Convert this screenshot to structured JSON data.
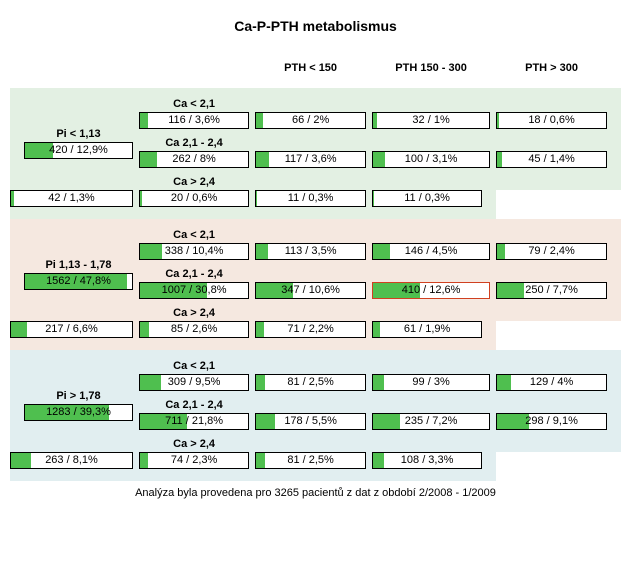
{
  "title": "Ca-P-PTH metabolismus",
  "footer": "Analýza byla provedena pro 3265 pacientů z dat z období 2/2008 - 1/2009",
  "headers": {
    "pth1": "PTH < 150",
    "pth2": "PTH 150 - 300",
    "pth3": "PTH > 300"
  },
  "pi_labels": [
    "Pi < 1,13",
    "Pi 1,13 - 1,78",
    "Pi > 1,78"
  ],
  "ca_labels": [
    "Ca < 2,1",
    "Ca 2,1 - 2,4",
    "Ca > 2,4"
  ],
  "chart_data": {
    "type": "table",
    "note": "Each cell shows count/percent of total (N=3265). pct_raw used for bar fill width in percent.",
    "total_n": 3265,
    "pi_bins": [
      "Pi < 1,13",
      "Pi 1,13 - 1,78",
      "Pi > 1,78"
    ],
    "ca_bins": [
      "Ca < 2,1",
      "Ca 2,1 - 2,4",
      "Ca > 2,4"
    ],
    "pth_bins": [
      "PTH < 150",
      "PTH 150 - 300",
      "PTH > 300"
    ],
    "pi_totals": [
      {
        "text": "420 / 12,9%",
        "pct_raw": 12.9
      },
      {
        "text": "1562 / 47,8%",
        "pct_raw": 47.8
      },
      {
        "text": "1283 / 39,3%",
        "pct_raw": 39.3
      }
    ],
    "ca_totals": [
      [
        {
          "text": "116 / 3,6%",
          "pct_raw": 3.6
        },
        {
          "text": "262 / 8%",
          "pct_raw": 8.0
        },
        {
          "text": "42 / 1,3%",
          "pct_raw": 1.3
        }
      ],
      [
        {
          "text": "338 / 10,4%",
          "pct_raw": 10.4
        },
        {
          "text": "1007 / 30,8%",
          "pct_raw": 30.8
        },
        {
          "text": "217 / 6,6%",
          "pct_raw": 6.6
        }
      ],
      [
        {
          "text": "309 / 9,5%",
          "pct_raw": 9.5
        },
        {
          "text": "711 / 21,8%",
          "pct_raw": 21.8
        },
        {
          "text": "263 / 8,1%",
          "pct_raw": 8.1
        }
      ]
    ],
    "cells": [
      [
        [
          {
            "text": "66 / 2%",
            "pct_raw": 2.0
          },
          {
            "text": "32 / 1%",
            "pct_raw": 1.0
          },
          {
            "text": "18 / 0,6%",
            "pct_raw": 0.6
          }
        ],
        [
          {
            "text": "117 / 3,6%",
            "pct_raw": 3.6
          },
          {
            "text": "100 / 3,1%",
            "pct_raw": 3.1
          },
          {
            "text": "45 / 1,4%",
            "pct_raw": 1.4
          }
        ],
        [
          {
            "text": "20 / 0,6%",
            "pct_raw": 0.6
          },
          {
            "text": "11 / 0,3%",
            "pct_raw": 0.3
          },
          {
            "text": "11 / 0,3%",
            "pct_raw": 0.3
          }
        ]
      ],
      [
        [
          {
            "text": "113 / 3,5%",
            "pct_raw": 3.5
          },
          {
            "text": "146 / 4,5%",
            "pct_raw": 4.5
          },
          {
            "text": "79 / 2,4%",
            "pct_raw": 2.4
          }
        ],
        [
          {
            "text": "347 / 10,6%",
            "pct_raw": 10.6
          },
          {
            "text": "410 / 12,6%",
            "pct_raw": 12.6,
            "highlight": true
          },
          {
            "text": "250 / 7,7%",
            "pct_raw": 7.7
          }
        ],
        [
          {
            "text": "85 / 2,6%",
            "pct_raw": 2.6
          },
          {
            "text": "71 / 2,2%",
            "pct_raw": 2.2
          },
          {
            "text": "61 / 1,9%",
            "pct_raw": 1.9
          }
        ]
      ],
      [
        [
          {
            "text": "81 / 2,5%",
            "pct_raw": 2.5
          },
          {
            "text": "99 / 3%",
            "pct_raw": 3.0
          },
          {
            "text": "129 / 4%",
            "pct_raw": 4.0
          }
        ],
        [
          {
            "text": "178 / 5,5%",
            "pct_raw": 5.5
          },
          {
            "text": "235 / 7,2%",
            "pct_raw": 7.2
          },
          {
            "text": "298 / 9,1%",
            "pct_raw": 9.1
          }
        ],
        [
          {
            "text": "74 / 2,3%",
            "pct_raw": 2.3
          },
          {
            "text": "81 / 2,5%",
            "pct_raw": 2.5
          },
          {
            "text": "108 / 3,3%",
            "pct_raw": 3.3
          }
        ]
      ]
    ]
  }
}
